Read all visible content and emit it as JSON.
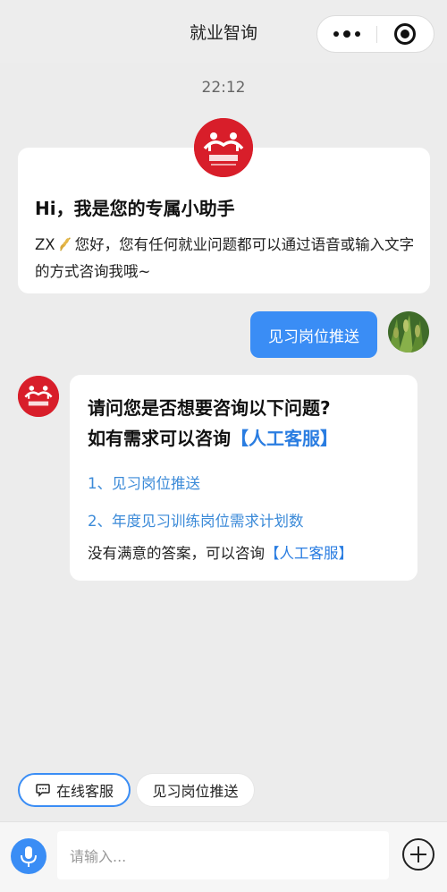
{
  "nav": {
    "title": "就业智询"
  },
  "chat": {
    "time": "22:12",
    "welcome": {
      "title": "Hi，我是您的专属小助手",
      "username": "ZX",
      "greeting": "您好，您有任何就业问题都可以通过语音或输入文字的方式咨询我哦~"
    },
    "user_message": "见习岗位推送",
    "bot_reply": {
      "question_line1": "请问您是否想要咨询以下问题?",
      "question_line2_prefix": "如有需求可以咨询",
      "question_link": "【人工客服】",
      "options": [
        "1、见习岗位推送",
        "2、年度见习训练岗位需求计划数"
      ],
      "footer_prefix": "没有满意的答案，可以咨询",
      "footer_link": "【人工客服】"
    }
  },
  "quick_replies": {
    "service": "在线客服",
    "push": "见习岗位推送"
  },
  "composer": {
    "placeholder": "请输入..."
  },
  "colors": {
    "accent": "#3a8df5",
    "logo_red": "#d81e2a",
    "link": "#2a7de1"
  },
  "icons": [
    "more-icon",
    "close-capsule-icon",
    "hangzhou-hrss-logo",
    "wheat-icon",
    "chat-icon",
    "mic-icon",
    "plus-icon"
  ]
}
